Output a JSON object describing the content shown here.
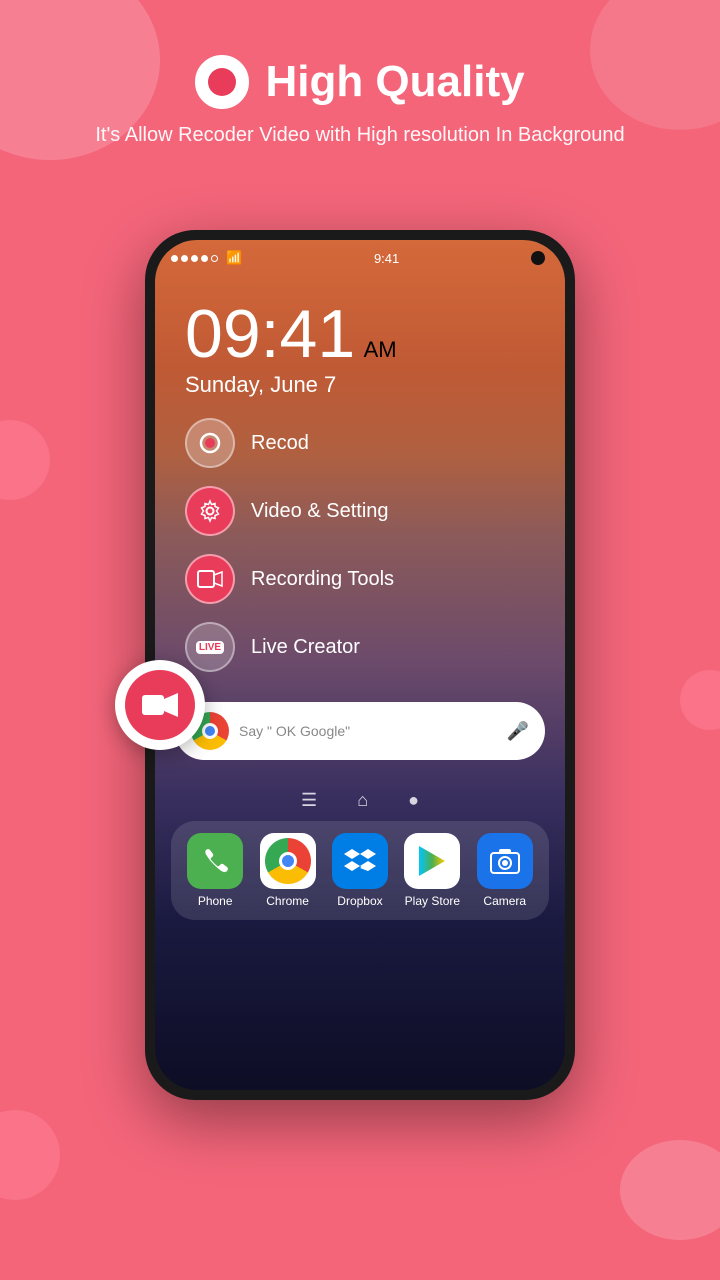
{
  "background_color": "#f4657a",
  "header": {
    "title": "High Quality",
    "subtitle": "It's Allow Recoder Video with High resolution In Background",
    "record_icon_alt": "record-icon"
  },
  "phone": {
    "status_bar": {
      "time": "9:41",
      "signal_dots": [
        "full",
        "full",
        "full",
        "full",
        "empty"
      ],
      "wifi": true,
      "camera_dot": true
    },
    "clock": {
      "time": "09:41",
      "ampm": "AM",
      "date": "Sunday, June 7"
    },
    "menu_items": [
      {
        "label": "Recod",
        "icon_type": "record"
      },
      {
        "label": "Video & Setting",
        "icon_type": "gear"
      },
      {
        "label": "Recording Tools",
        "icon_type": "film"
      },
      {
        "label": "Live Creator",
        "icon_type": "live"
      }
    ],
    "search_bar": {
      "placeholder": "Say \" OK Google\"",
      "g_letter": "G"
    },
    "nav_buttons": [
      "menu",
      "home",
      "recents"
    ],
    "dock_apps": [
      {
        "name": "Phone",
        "icon": "phone"
      },
      {
        "name": "Chrome",
        "icon": "chrome"
      },
      {
        "name": "Dropbox",
        "icon": "dropbox"
      },
      {
        "name": "Play Store",
        "icon": "playstore"
      },
      {
        "name": "Camera",
        "icon": "camera"
      }
    ]
  },
  "floating_button": {
    "icon": "video-camera-icon",
    "alt": "Video Recorder Float Button"
  }
}
